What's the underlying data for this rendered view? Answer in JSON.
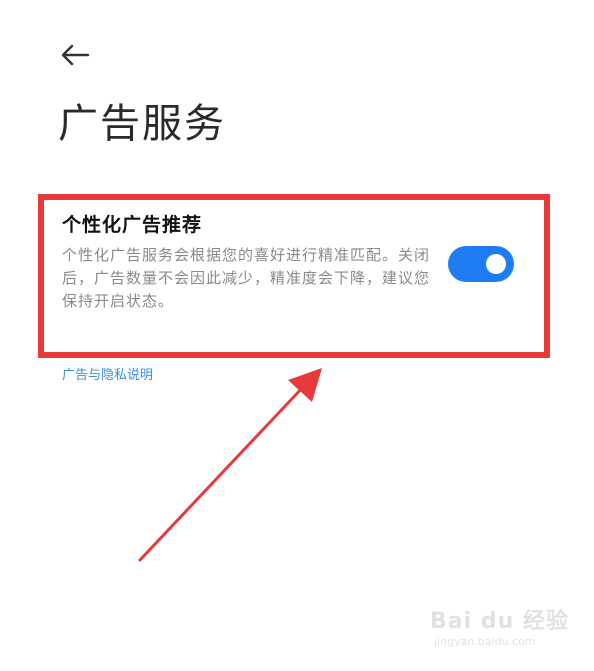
{
  "header": {
    "back_icon": "arrow-left-icon",
    "title": "广告服务"
  },
  "setting": {
    "title": "个性化广告推荐",
    "description": "个性化广告服务会根据您的喜好进行精准匹配。关闭后，广告数量不会因此减少，精准度会下降，建议您保持开启状态。",
    "toggle_state": "on"
  },
  "links": {
    "privacy": "广告与隐私说明"
  },
  "colors": {
    "accent": "#1f7cf2",
    "annotation": "#e83a3a",
    "link": "#3a8fe0"
  },
  "watermark": {
    "brand": "Bai du 经验",
    "url": "jingyan.baidu.com"
  }
}
